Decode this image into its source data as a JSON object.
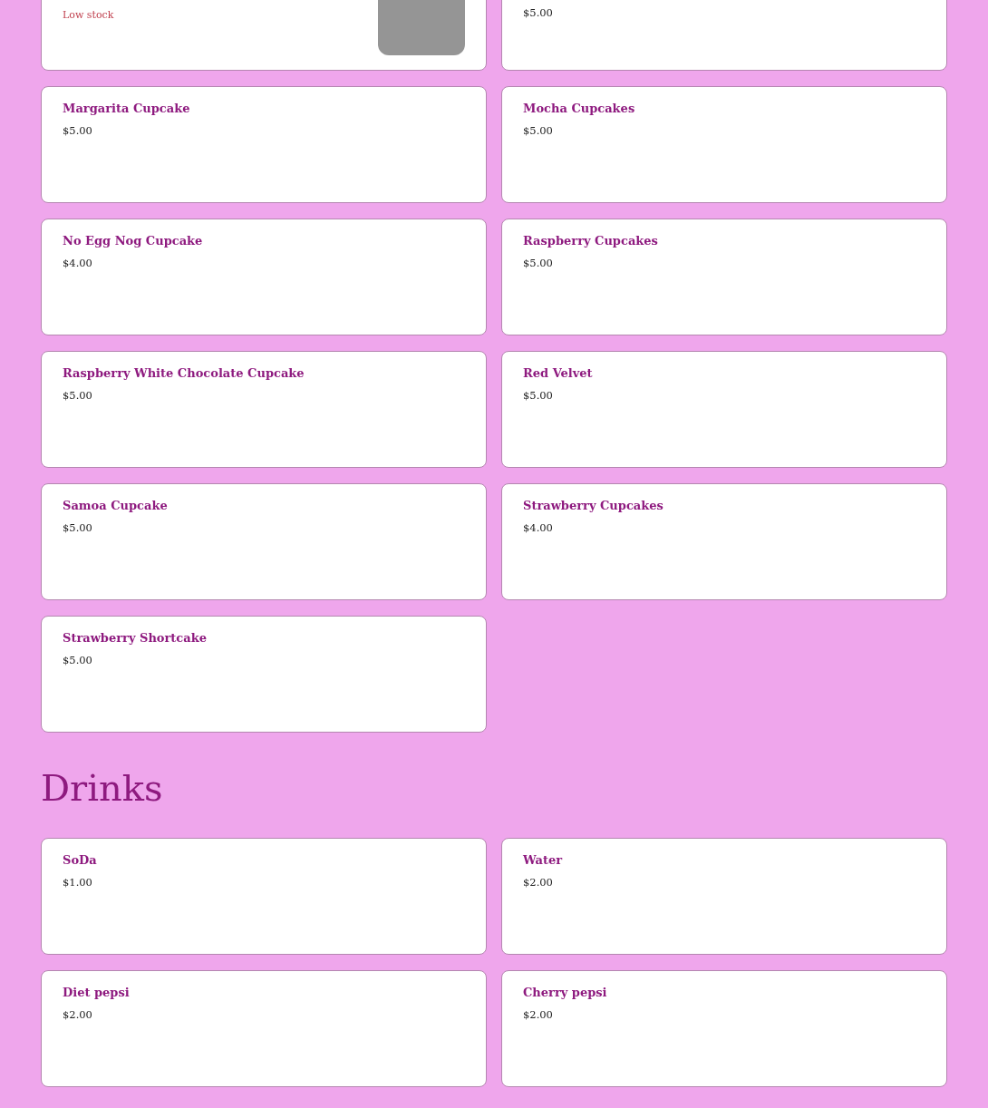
{
  "sections": [
    {
      "items": [
        {
          "note": "Low stock",
          "photo": true
        },
        {
          "price": "$5.00"
        },
        {
          "name": "Margarita Cupcake",
          "price": "$5.00"
        },
        {
          "name": "Mocha Cupcakes",
          "price": "$5.00"
        },
        {
          "name": "No Egg Nog Cupcake",
          "price": "$4.00"
        },
        {
          "name": "Raspberry Cupcakes",
          "price": "$5.00"
        },
        {
          "name": "Raspberry White Chocolate Cupcake",
          "price": "$5.00"
        },
        {
          "name": "Red Velvet",
          "price": "$5.00"
        },
        {
          "name": "Samoa Cupcake",
          "price": "$5.00"
        },
        {
          "name": "Strawberry Cupcakes",
          "price": "$4.00"
        },
        {
          "name": "Strawberry Shortcake",
          "price": "$5.00"
        }
      ]
    },
    {
      "heading": "Drinks",
      "items": [
        {
          "name": "SoDa",
          "price": "$1.00"
        },
        {
          "name": "Water",
          "price": "$2.00"
        },
        {
          "name": "Diet pepsi",
          "price": "$2.00"
        },
        {
          "name": "Cherry pepsi",
          "price": "$2.00"
        }
      ]
    }
  ]
}
